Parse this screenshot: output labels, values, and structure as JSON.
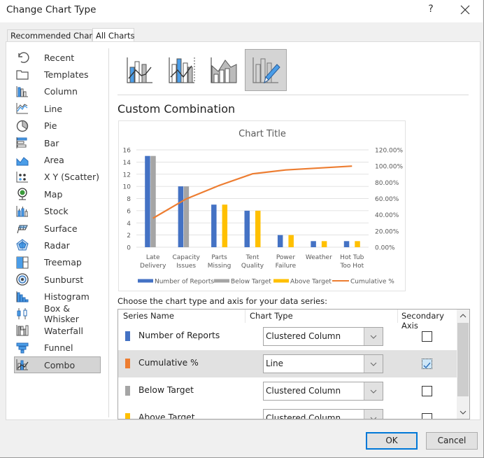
{
  "window": {
    "title": "Change Chart Type",
    "help_label": "?",
    "close_icon": "close-icon"
  },
  "tabs": [
    {
      "label": "Recommended Charts",
      "active": false
    },
    {
      "label": "All Charts",
      "active": true
    }
  ],
  "sidebar": {
    "items": [
      {
        "label": "Recent",
        "icon": "recent-icon"
      },
      {
        "label": "Templates",
        "icon": "templates-icon"
      },
      {
        "label": "Column",
        "icon": "column-chart-icon"
      },
      {
        "label": "Line",
        "icon": "line-chart-icon"
      },
      {
        "label": "Pie",
        "icon": "pie-chart-icon"
      },
      {
        "label": "Bar",
        "icon": "bar-chart-icon"
      },
      {
        "label": "Area",
        "icon": "area-chart-icon"
      },
      {
        "label": "X Y (Scatter)",
        "icon": "scatter-chart-icon"
      },
      {
        "label": "Map",
        "icon": "map-chart-icon"
      },
      {
        "label": "Stock",
        "icon": "stock-chart-icon"
      },
      {
        "label": "Surface",
        "icon": "surface-chart-icon"
      },
      {
        "label": "Radar",
        "icon": "radar-chart-icon"
      },
      {
        "label": "Treemap",
        "icon": "treemap-chart-icon"
      },
      {
        "label": "Sunburst",
        "icon": "sunburst-chart-icon"
      },
      {
        "label": "Histogram",
        "icon": "histogram-chart-icon"
      },
      {
        "label": "Box & Whisker",
        "icon": "box-whisker-chart-icon"
      },
      {
        "label": "Waterfall",
        "icon": "waterfall-chart-icon"
      },
      {
        "label": "Funnel",
        "icon": "funnel-chart-icon"
      },
      {
        "label": "Combo",
        "icon": "combo-chart-icon",
        "selected": true
      }
    ]
  },
  "subtypes": [
    {
      "name": "clustered-column-line",
      "selected": false
    },
    {
      "name": "clustered-column-line-secondary-axis",
      "selected": false
    },
    {
      "name": "stacked-area-clustered-column",
      "selected": false
    },
    {
      "name": "custom-combination",
      "selected": true
    }
  ],
  "section_title": "Custom Combination",
  "chart_data": {
    "type": "bar",
    "title": "Chart Title",
    "categories": [
      "Late Delivery",
      "Capacity Issues",
      "Parts Missing",
      "Tent Quality",
      "Power Failure",
      "Weather",
      "Hot Tub Too Hot"
    ],
    "category_lines": [
      [
        "Late",
        "Delivery"
      ],
      [
        "Capacity",
        "Issues"
      ],
      [
        "Parts",
        "Missing"
      ],
      [
        "Tent",
        "Quality"
      ],
      [
        "Power",
        "Failure"
      ],
      [
        "Weather",
        ""
      ],
      [
        "Hot Tub",
        "Too Hot"
      ]
    ],
    "series": [
      {
        "name": "Number of Reports",
        "type": "column",
        "axis": "primary",
        "color": "#4472c4",
        "values": [
          15,
          10,
          7,
          6,
          2,
          1,
          1
        ]
      },
      {
        "name": "Below Target",
        "type": "column",
        "axis": "primary",
        "color": "#a5a5a5",
        "values": [
          15,
          10,
          0,
          0,
          0,
          0,
          0
        ]
      },
      {
        "name": "Above Target",
        "type": "column",
        "axis": "primary",
        "color": "#ffc000",
        "values": [
          0,
          0,
          7,
          6,
          2,
          1,
          1
        ]
      },
      {
        "name": "Cumulative %",
        "type": "line",
        "axis": "secondary",
        "color": "#ed7d31",
        "values": [
          35.71,
          59.52,
          76.19,
          90.48,
          95.24,
          97.62,
          100.0
        ]
      }
    ],
    "y_primary": {
      "min": 0,
      "max": 16,
      "step": 2,
      "ticks": [
        "0",
        "2",
        "4",
        "6",
        "8",
        "10",
        "12",
        "14",
        "16"
      ]
    },
    "y_secondary": {
      "min": 0,
      "max": 120,
      "step": 20,
      "ticks": [
        "0.00%",
        "20.00%",
        "40.00%",
        "60.00%",
        "80.00%",
        "100.00%",
        "120.00%"
      ]
    },
    "legend": {
      "position": "bottom",
      "entries": [
        "Number of Reports",
        "Below Target",
        "Above Target",
        "Cumulative %"
      ]
    },
    "grid": true,
    "xlabel": "",
    "ylabel": ""
  },
  "series_table": {
    "instruction": "Choose the chart type and axis for your data series:",
    "headers": {
      "series_name": "Series Name",
      "chart_type": "Chart Type",
      "secondary_axis": "Secondary Axis"
    },
    "rows": [
      {
        "name": "Number of Reports",
        "color": "#4472c4",
        "chart_type": "Clustered Column",
        "secondary_axis": false,
        "selected": false
      },
      {
        "name": "Cumulative %",
        "color": "#ed7d31",
        "chart_type": "Line",
        "secondary_axis": true,
        "selected": true
      },
      {
        "name": "Below Target",
        "color": "#a5a5a5",
        "chart_type": "Clustered Column",
        "secondary_axis": false,
        "selected": false
      },
      {
        "name": "Above Target",
        "color": "#ffc000",
        "chart_type": "Clustered Column",
        "secondary_axis": false,
        "selected": false
      }
    ]
  },
  "buttons": {
    "ok": "OK",
    "cancel": "Cancel"
  },
  "colors": {
    "accent": "#0078d7",
    "icon_blue": "#4a9de8",
    "icon_gray": "#555555"
  }
}
